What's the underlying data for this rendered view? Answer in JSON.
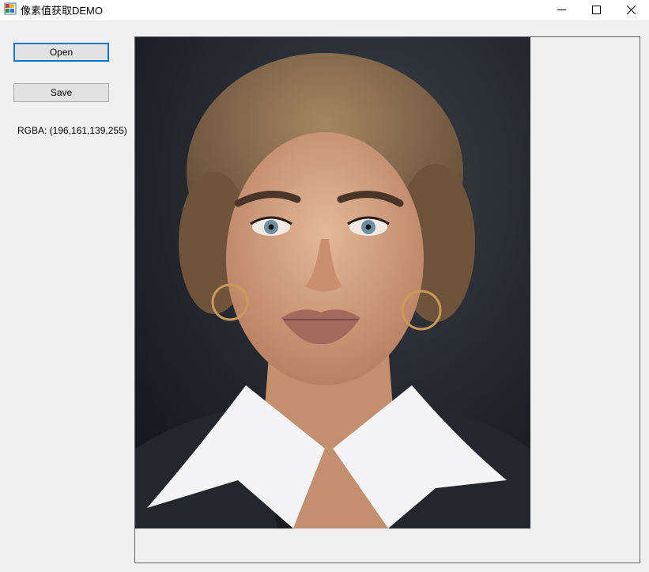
{
  "window": {
    "title": "像素值获取DEMO",
    "icon": "app-window-icon",
    "controls": [
      "minimize-icon",
      "maximize-icon",
      "close-icon"
    ]
  },
  "controls": {
    "open_label": "Open",
    "save_label": "Save",
    "rgba_text": "RGBA: (196,161,139,255)"
  },
  "image": {
    "description_icon": "portrait-photo",
    "colors": {
      "background_dark": "#1f242b",
      "hair": "#8a6b4a",
      "skin": "#d9ab8a",
      "lips": "#a26a5c",
      "shirt": "#f4f4f6",
      "jacket": "#23262c"
    }
  }
}
